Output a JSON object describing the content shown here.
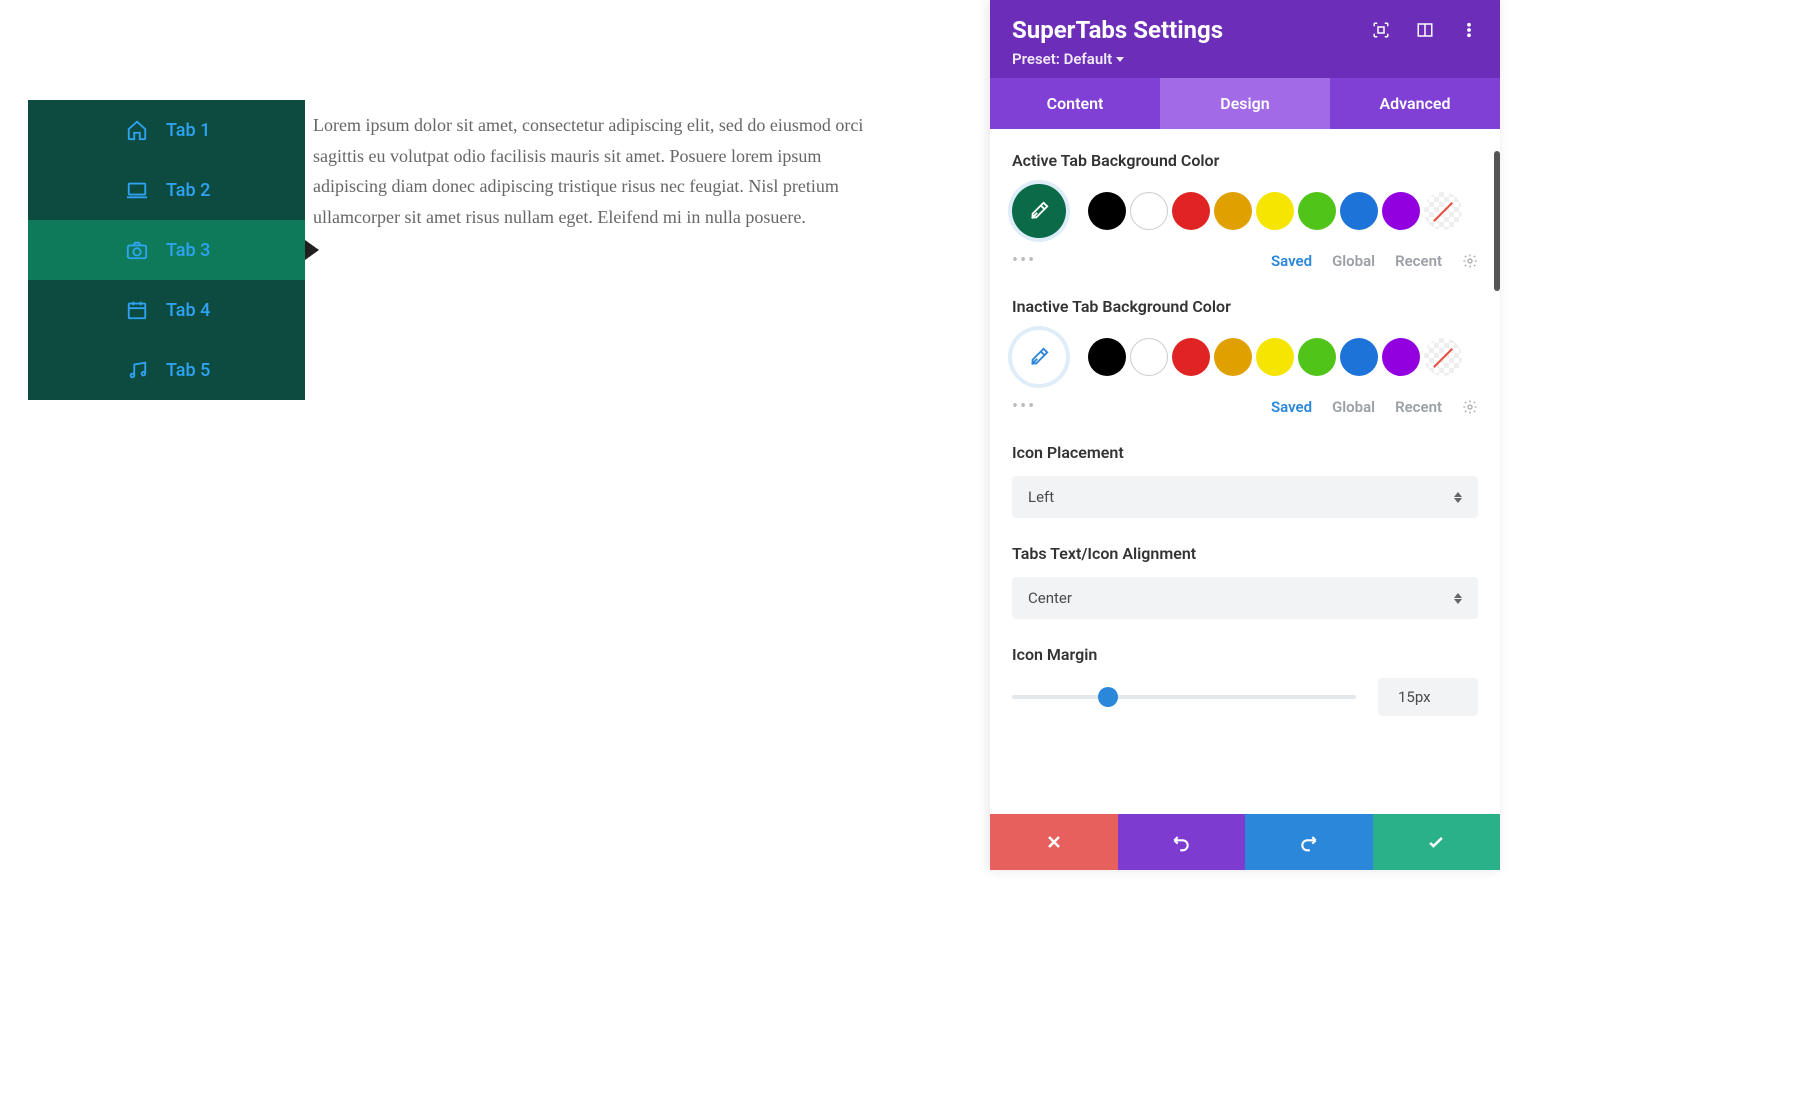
{
  "preview": {
    "tabs": [
      {
        "label": "Tab 1",
        "icon": "home-icon"
      },
      {
        "label": "Tab 2",
        "icon": "laptop-icon"
      },
      {
        "label": "Tab 3",
        "icon": "camera-icon"
      },
      {
        "label": "Tab 4",
        "icon": "calendar-icon"
      },
      {
        "label": "Tab 5",
        "icon": "music-icon"
      }
    ],
    "active_index": 2,
    "content_text": "Lorem ipsum dolor sit amet, consectetur adipiscing elit, sed do eiusmod orci sagittis eu volutpat odio facilisis mauris sit amet. Posuere lorem ipsum adipiscing diam donec adipiscing tristique risus nec feugiat. Nisl pretium ullamcorper sit amet risus nullam eget. Eleifend mi in nulla posuere."
  },
  "panel": {
    "title": "SuperTabs Settings",
    "preset_label": "Preset: Default",
    "tabs": {
      "content": "Content",
      "design": "Design",
      "advanced": "Advanced",
      "active": "design"
    },
    "sections": {
      "active_bg": {
        "label": "Active Tab Background Color",
        "selected_color": "#0b6a47",
        "dropper_stroke": "#ffffff",
        "palette": [
          "#000000",
          "#ffffff",
          "#e02424",
          "#e0a000",
          "#f5e500",
          "#51c41a",
          "#1e73d8",
          "#9300e0"
        ],
        "tabs": {
          "saved": "Saved",
          "global": "Global",
          "recent": "Recent",
          "active": "saved"
        }
      },
      "inactive_bg": {
        "label": "Inactive Tab Background Color",
        "selected_color": "#ffffff",
        "dropper_stroke": "#2b87da",
        "palette": [
          "#000000",
          "#ffffff",
          "#e02424",
          "#e0a000",
          "#f5e500",
          "#51c41a",
          "#1e73d8",
          "#9300e0"
        ],
        "tabs": {
          "saved": "Saved",
          "global": "Global",
          "recent": "Recent",
          "active": "saved"
        }
      },
      "icon_placement": {
        "label": "Icon Placement",
        "value": "Left"
      },
      "text_align": {
        "label": "Tabs Text/Icon Alignment",
        "value": "Center"
      },
      "icon_margin": {
        "label": "Icon Margin",
        "value": "15px",
        "percent": 28
      }
    }
  }
}
